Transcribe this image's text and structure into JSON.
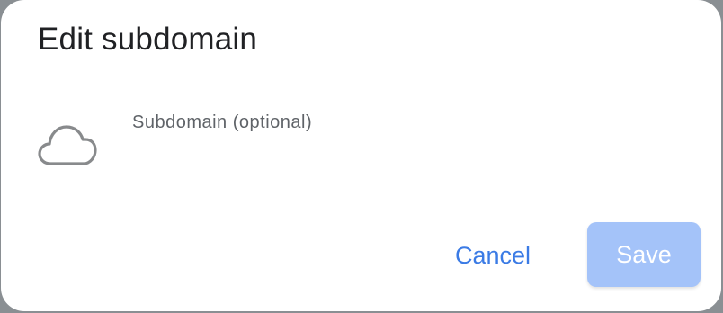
{
  "dialog": {
    "title": "Edit subdomain",
    "field": {
      "icon": "cloud-icon",
      "label": "Subdomain (optional)",
      "value": ""
    },
    "actions": {
      "cancel_label": "Cancel",
      "save_label": "Save",
      "save_disabled": true
    }
  },
  "colors": {
    "accent": "#3b7be5",
    "save_disabled_bg": "#a4c3f9",
    "title_text": "#202124",
    "label_text": "#5f6368",
    "icon": "#888a8c"
  }
}
